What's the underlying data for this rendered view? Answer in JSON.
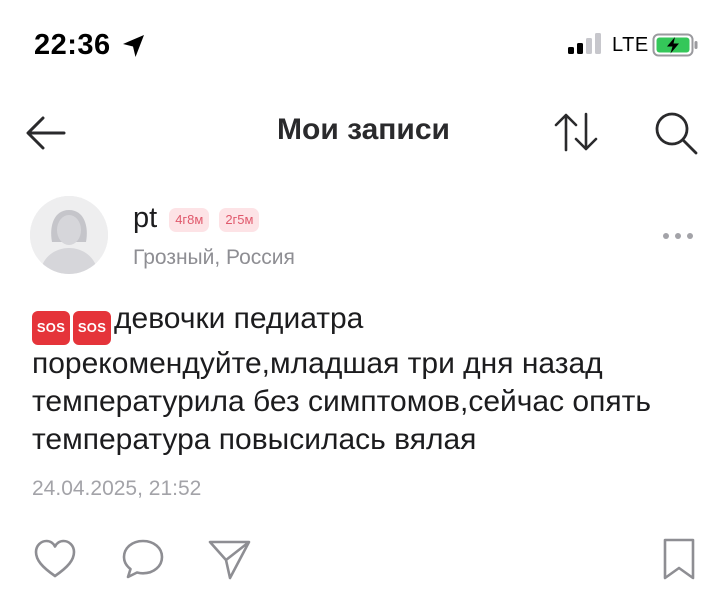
{
  "status_bar": {
    "time": "22:36",
    "network": "LTE",
    "icons": [
      "location-arrow-icon",
      "signal-icon",
      "battery-charging-icon"
    ]
  },
  "header": {
    "title": "Мои записи",
    "icons": [
      "back-arrow-icon",
      "sort-icon",
      "search-icon"
    ]
  },
  "post": {
    "author": "pt",
    "badges": [
      "4г8м",
      "2г5м"
    ],
    "location": "Грозный, Россия",
    "emoji": [
      "SOS",
      "SOS"
    ],
    "text": "девочки педиатра порекомендуйте,младшая три дня назад температурила без симптомов,сейчас опять температура повысилась вялая",
    "date": "24.04.2025, 21:52",
    "actions": [
      "like-icon",
      "comment-icon",
      "share-icon",
      "bookmark-icon"
    ]
  },
  "colors": {
    "badge_bg": "#fde3e6",
    "badge_text": "#e0596c",
    "sos_red": "#e5343a",
    "muted_text": "#8e8e93"
  }
}
